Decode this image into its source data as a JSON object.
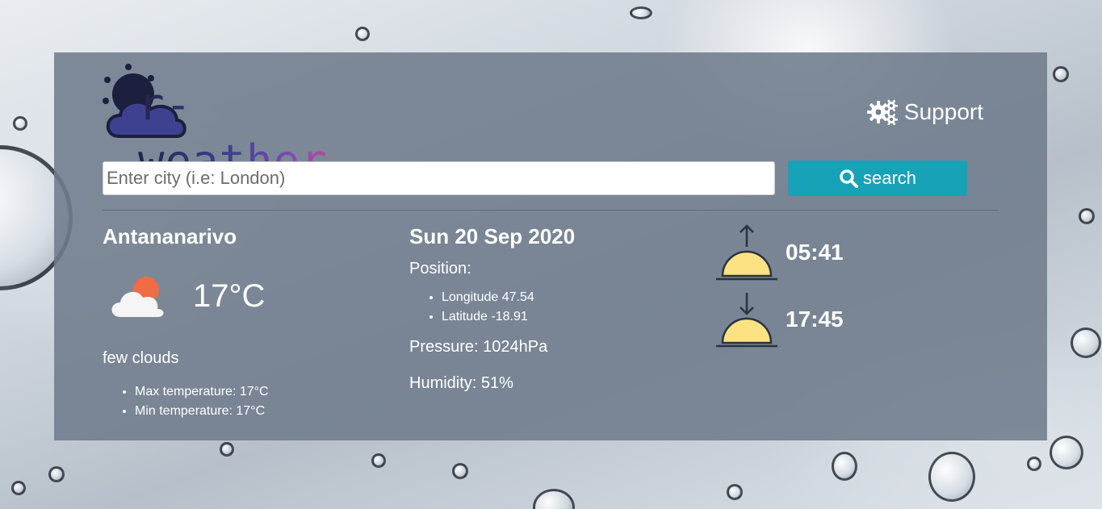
{
  "header": {
    "logo_text": "r-weather",
    "support_label": "Support"
  },
  "search": {
    "placeholder": "Enter city (i.e: London)",
    "value": "",
    "button_label": "search"
  },
  "current": {
    "city": "Antananarivo",
    "temperature": "17°C",
    "description": "few clouds",
    "details": [
      "Max temperature: 17°C",
      "Min temperature: 17°C"
    ]
  },
  "info": {
    "date": "Sun 20 Sep 2020",
    "position_label": "Position:",
    "position": [
      "Longitude 47.54",
      "Latitude -18.91"
    ],
    "pressure": "Pressure: 1024hPa",
    "humidity": "Humidity: 51%"
  },
  "sun": {
    "sunrise": "05:41",
    "sunset": "17:45"
  },
  "icons": {
    "settings": "gears-icon",
    "search": "search-icon",
    "weather": "cloud-sun-icon",
    "sunrise": "sunrise-icon",
    "sunset": "sunset-icon"
  },
  "colors": {
    "panel": "#6f7c8c",
    "search_button": "#17a2b8",
    "sun": "#fde283",
    "cloud_sun": "#ef6c47"
  }
}
